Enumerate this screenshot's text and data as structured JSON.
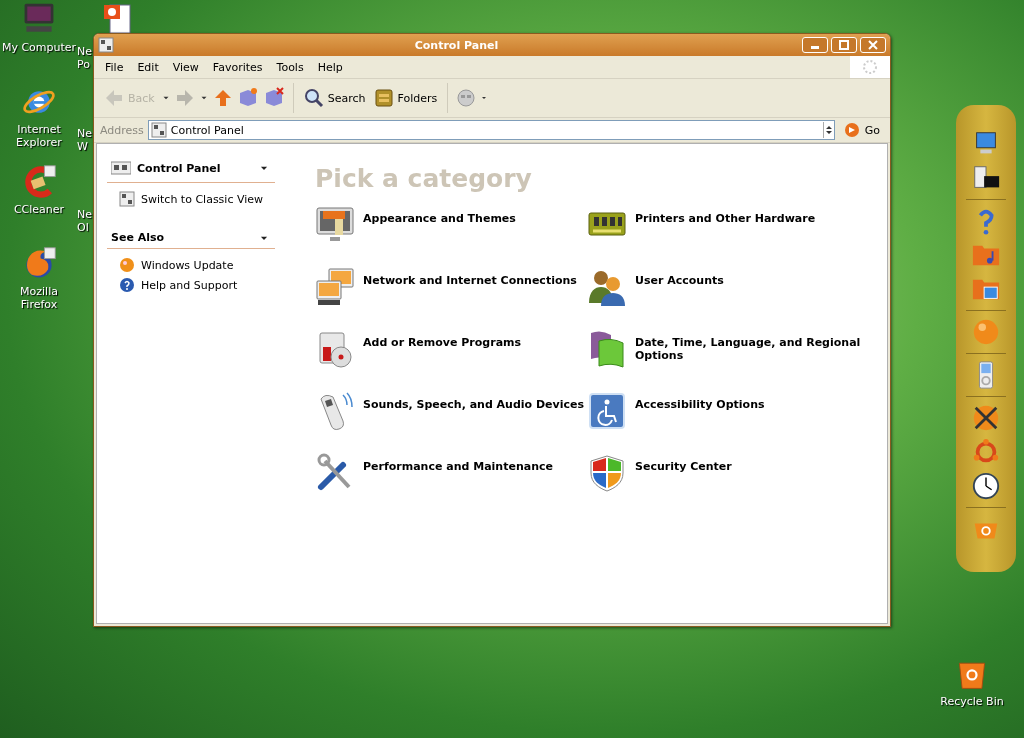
{
  "desktop": {
    "icons": [
      {
        "label": "My Computer"
      },
      {
        "label": "Internet Explorer"
      },
      {
        "label": "CCleaner"
      },
      {
        "label": "Mozilla Firefox"
      }
    ],
    "hidden_icons": [
      {
        "lines": [
          "Ne",
          "Po"
        ]
      },
      {
        "lines": [
          "Ne",
          "W"
        ]
      },
      {
        "lines": [
          "Ne",
          "Ol"
        ]
      }
    ],
    "recycle_bin": {
      "label": "Recycle Bin"
    }
  },
  "window": {
    "title": "Control Panel",
    "menu": [
      "File",
      "Edit",
      "View",
      "Favorites",
      "Tools",
      "Help"
    ],
    "toolbar": {
      "back": {
        "label": "Back",
        "disabled": true
      },
      "search": {
        "label": "Search"
      },
      "folders": {
        "label": "Folders"
      }
    },
    "address": {
      "label": "Address",
      "value": "Control Panel",
      "go": "Go"
    },
    "sidebar": {
      "sections": [
        {
          "title": "Control Panel",
          "items": [
            "Switch to Classic View"
          ]
        },
        {
          "title": "See Also",
          "items": [
            "Windows Update",
            "Help and Support"
          ]
        }
      ]
    },
    "main": {
      "heading": "Pick a category",
      "categories": [
        {
          "label": "Appearance and Themes"
        },
        {
          "label": "Printers and Other Hardware"
        },
        {
          "label": "Network and Internet Connections"
        },
        {
          "label": "User Accounts"
        },
        {
          "label": "Add or Remove Programs"
        },
        {
          "label": "Date, Time, Language, and Regional Options"
        },
        {
          "label": "Sounds, Speech, and Audio Devices"
        },
        {
          "label": "Accessibility Options"
        },
        {
          "label": "Performance and Maintenance"
        },
        {
          "label": "Security Center"
        }
      ]
    }
  }
}
